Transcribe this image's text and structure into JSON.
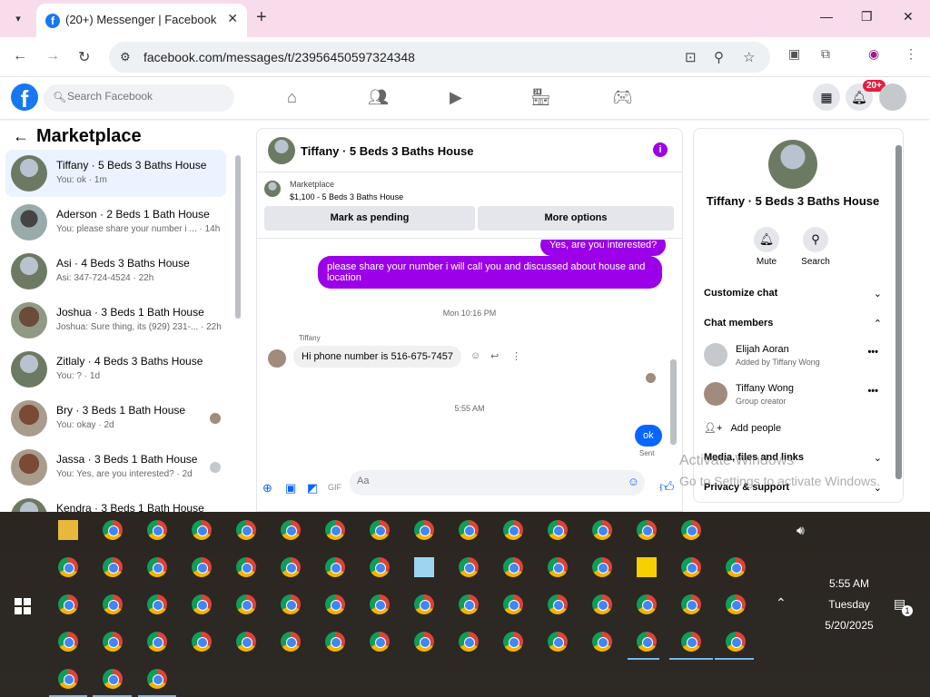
{
  "browser": {
    "tab_title": "(20+) Messenger | Facebook",
    "url": "facebook.com/messages/t/23956450597324348"
  },
  "fb": {
    "search_placeholder": "Search Facebook",
    "notification_badge": "20+"
  },
  "left": {
    "title": "Marketplace",
    "conversations": [
      {
        "name": "Tiffany · 5 Beds 3 Baths House",
        "sub": "You: ok · 1m"
      },
      {
        "name": "Aderson · 2 Beds 1 Bath House",
        "sub": "You: please share your number i ... · 14h"
      },
      {
        "name": "Asi · 4 Beds 3 Baths House",
        "sub": "Asi: 347-724-4524 · 22h"
      },
      {
        "name": "Joshua · 3 Beds 1 Bath House",
        "sub": "Joshua: Sure thing, its (929) 231-... · 22h"
      },
      {
        "name": "Zitlaly · 4 Beds 3 Baths House",
        "sub": "You: ? · 1d"
      },
      {
        "name": "Bry · 3 Beds 1 Bath House",
        "sub": "You: okay · 2d"
      },
      {
        "name": "Jassa · 3 Beds 1 Bath House",
        "sub": "You: Yes, are you interested? · 2d"
      },
      {
        "name": "Kendra · 3 Beds 1 Bath House",
        "sub": ""
      }
    ]
  },
  "chat": {
    "title": "Tiffany · 5 Beds 3 Baths House",
    "marketplace_label": "Marketplace",
    "listing": "$1,100 - 5 Beds 3 Baths House",
    "btn_pending": "Mark as pending",
    "btn_more": "More options",
    "msg_out_1": "Yes, are you interested?",
    "msg_out_2": "please share your number i will call you and discussed about house and location",
    "ts_1": "Mon 10:16 PM",
    "sender": "Tiffany",
    "msg_in_1": "Hi phone number is 516-675-7457",
    "ts_2": "5:55 AM",
    "msg_out_3": "ok",
    "sent_label": "Sent",
    "composer_placeholder": "Aa"
  },
  "right": {
    "name": "Tiffany · 5 Beds 3 Baths House",
    "mute_label": "Mute",
    "search_label": "Search",
    "customize": "Customize chat",
    "members_title": "Chat members",
    "members": [
      {
        "name": "Elijah Aoran",
        "role": "Added by Tiffany Wong"
      },
      {
        "name": "Tiffany Wong",
        "role": "Group creator"
      }
    ],
    "add_people": "Add people",
    "media": "Media, files and links",
    "privacy": "Privacy & support"
  },
  "watermark": {
    "line1": "Activate Windows",
    "line2": "Go to Settings to activate Windows."
  },
  "taskbar": {
    "time": "5:55 AM",
    "day": "Tuesday",
    "date": "5/20/2025",
    "notif_count": "1"
  }
}
